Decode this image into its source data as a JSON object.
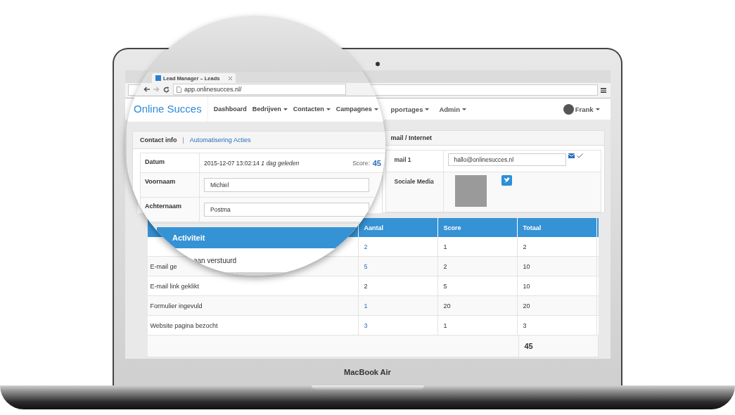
{
  "browser": {
    "tab_title": "Lead Manager – Leads",
    "address": "app.onlinesucces.nl/"
  },
  "zoom_navbar": {
    "logo": "Online Succes",
    "items": [
      {
        "label": "Dashboard",
        "dropdown": false
      },
      {
        "label": "Bedrijven",
        "dropdown": true
      },
      {
        "label": "Contacten",
        "dropdown": true
      },
      {
        "label": "Campagnes",
        "dropdown": true
      }
    ]
  },
  "contact_panel": {
    "tabs": [
      {
        "label": "Contact info",
        "selected": true
      },
      {
        "label": "Automatisering Acties",
        "selected": false
      }
    ],
    "separator": "|",
    "datum": {
      "label": "Datum",
      "value": "2015-12-07 13:02:14",
      "note": "1 dag geleden",
      "score_label": "Score:",
      "score": "45"
    },
    "fields": [
      {
        "label": "Voornaam",
        "value": "Michiel"
      },
      {
        "label": "Achternaam",
        "value": "Postma"
      }
    ]
  },
  "zoom_activity": {
    "header": "Activiteit",
    "row_label": "aan verstuurd"
  },
  "navbar": {
    "items": [
      {
        "label": "pportages",
        "dropdown": true
      },
      {
        "label": "Admin",
        "dropdown": true
      }
    ],
    "user": "Frank"
  },
  "email_panel": {
    "title": "mail / Internet",
    "rows": [
      {
        "kind": "email",
        "label": "mail 1",
        "value": "hallo@onlinesucces.nl",
        "verified": true
      },
      {
        "kind": "social",
        "label": "Sociale Media"
      }
    ]
  },
  "activity_table": {
    "columns": [
      "Aantal",
      "Score",
      "Totaal"
    ],
    "rows": [
      {
        "count": "2",
        "linked": true,
        "score": "1",
        "total": "2"
      },
      {
        "label": "E-mail ge",
        "count": "5",
        "linked": true,
        "score": "2",
        "total": "10"
      },
      {
        "label": "E-mail link geklikt",
        "count": "2",
        "linked": false,
        "score": "5",
        "total": "10"
      },
      {
        "label": "Formulier ingevuld",
        "count": "1",
        "linked": true,
        "score": "20",
        "total": "20"
      },
      {
        "label": "Website pagina bezocht",
        "count": "3",
        "linked": true,
        "score": "1",
        "total": "3"
      }
    ],
    "grand_total": "45"
  },
  "device": {
    "label": "MacBook Air"
  }
}
